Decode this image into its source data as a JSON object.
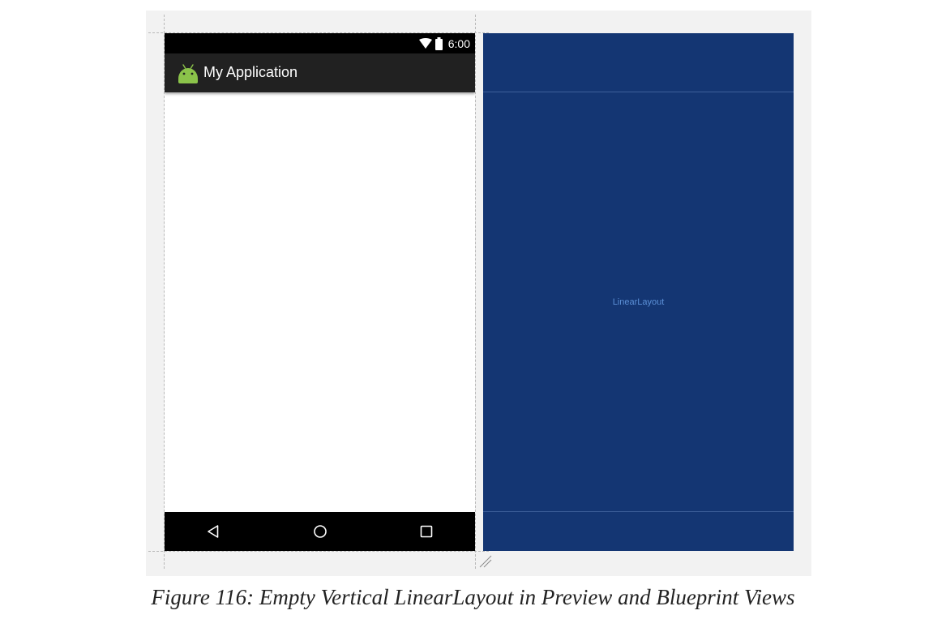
{
  "preview": {
    "status_bar": {
      "time": "6:00",
      "icons": [
        "wifi-icon",
        "battery-icon"
      ]
    },
    "action_bar": {
      "app_icon": "android-robot-icon",
      "title": "My Application"
    },
    "nav_bar": {
      "buttons": [
        "back-triangle-icon",
        "home-circle-icon",
        "recents-square-icon"
      ]
    }
  },
  "blueprint": {
    "layout_label": "LinearLayout"
  },
  "caption": "Figure 116: Empty Vertical LinearLayout in Preview and Blueprint Views",
  "colors": {
    "panel_background": "#f2f2f2",
    "status_bar": "#000000",
    "action_bar": "#212121",
    "nav_bar": "#000000",
    "android_green": "#8bc34a",
    "blueprint_background": "#143673",
    "blueprint_text": "#5b8fd6",
    "blueprint_lines": "#3d5f9a"
  }
}
